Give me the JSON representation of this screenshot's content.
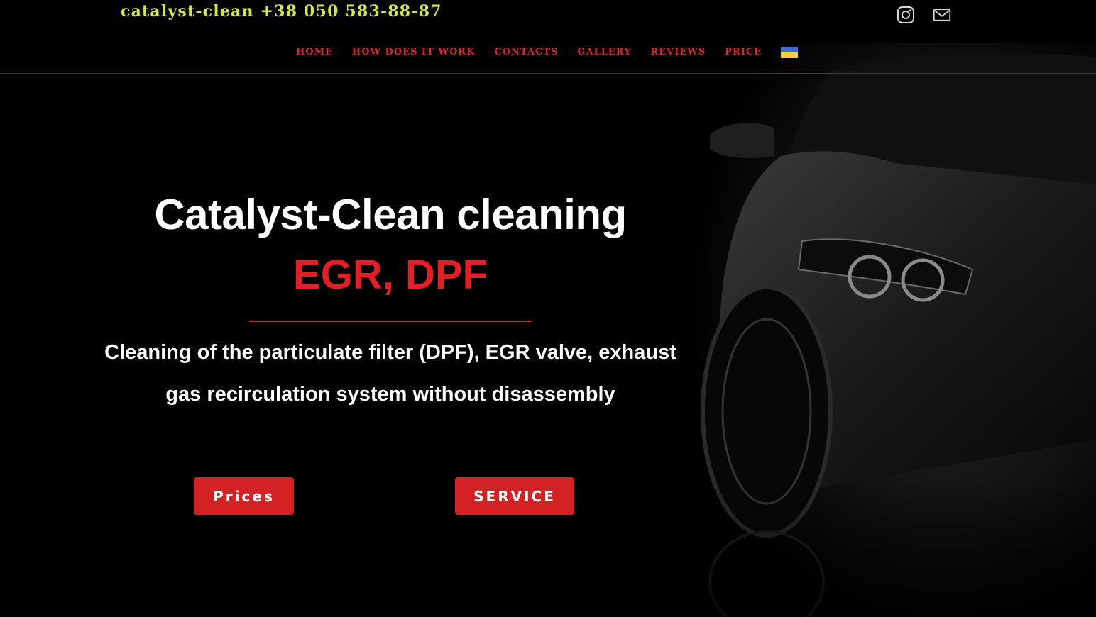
{
  "topbar": {
    "brand": "catalyst-clean",
    "phone": "+38 050 583-88-87",
    "icons": [
      "instagram-icon",
      "mail-icon"
    ]
  },
  "nav": {
    "items": [
      {
        "label": "HOME"
      },
      {
        "label": "HOW DOES IT WORK"
      },
      {
        "label": "CONTACTS"
      },
      {
        "label": "GALLERY"
      },
      {
        "label": "REVIEWS"
      },
      {
        "label": "PRICE"
      }
    ],
    "language_flag": "ukraine-flag-icon"
  },
  "hero": {
    "title": "Catalyst-Clean cleaning",
    "subtitle": "EGR, DPF",
    "description_line1": "Cleaning of the particulate filter (DPF), EGR valve, exhaust",
    "description_line2": "gas recirculation system without disassembly"
  },
  "buttons": {
    "prices": "Prices",
    "service": "SERVICE"
  },
  "colors": {
    "background": "#000000",
    "brand_yellow": "#d4e84a",
    "accent_red": "#e31e24",
    "button_red": "#d32124",
    "nav_red": "#e02626"
  }
}
